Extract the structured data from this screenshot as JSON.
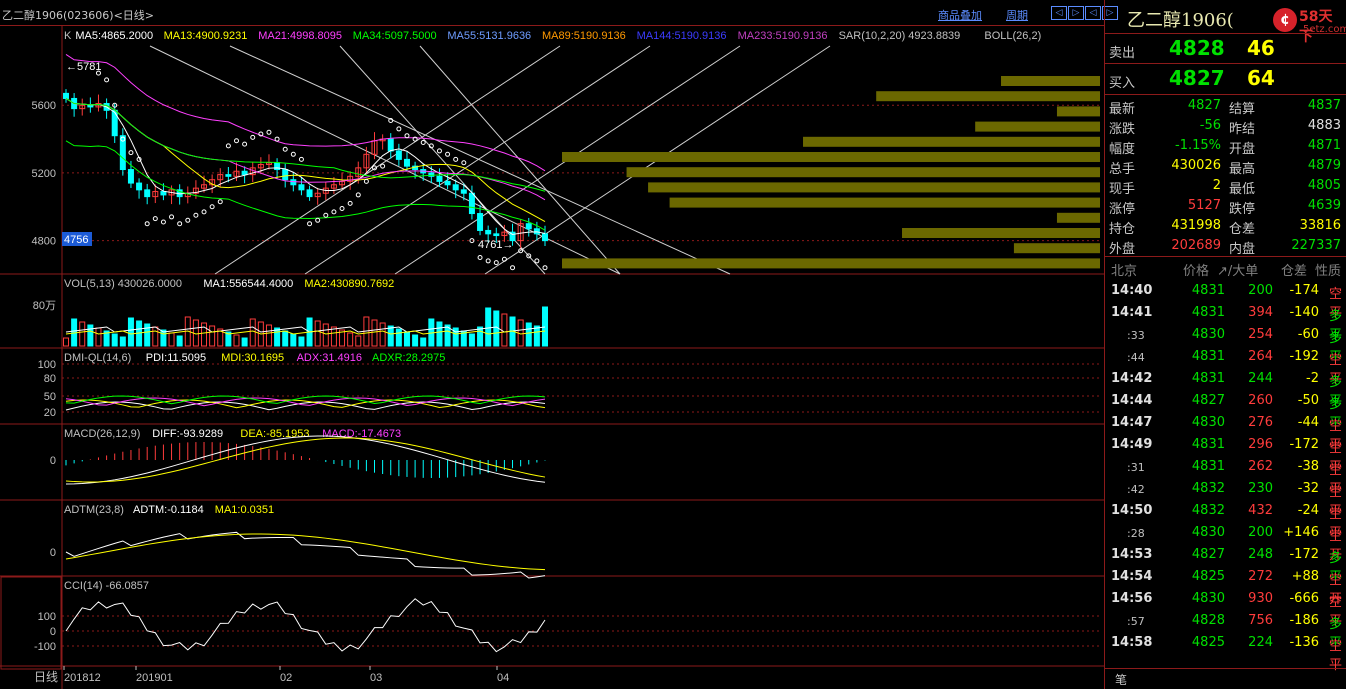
{
  "window_title": "乙二醇1906(023606)<日线>",
  "top_links": {
    "overlay": "商品叠加",
    "period": "周期"
  },
  "nav_buttons": [
    "◁",
    "▷",
    "◁",
    "▷"
  ],
  "colors": {
    "bg": "#000000",
    "up": "#ff3c3c",
    "down": "#00ffff",
    "grid": "#8c1a1a",
    "green": "#00e000",
    "yellow": "#ffff00"
  },
  "chart_data": [
    {
      "type": "candlestick",
      "ma_legend": [
        {
          "text": "K",
          "color": "#c0c0c0"
        },
        {
          "text": "MA5:4865.2000",
          "color": "#ffffff"
        },
        {
          "text": "MA13:4900.9231",
          "color": "#ffff00"
        },
        {
          "text": "MA21:4998.8095",
          "color": "#ff40ff"
        },
        {
          "text": "MA34:5097.5000",
          "color": "#00ff00"
        },
        {
          "text": "MA55:5131.9636",
          "color": "#6e9cff"
        },
        {
          "text": "MA89:5190.9136",
          "color": "#ff9900"
        },
        {
          "text": "MA144:5190.9136",
          "color": "#3c3cff"
        },
        {
          "text": "MA233:5190.9136",
          "color": "#c040c0"
        },
        {
          "text": "SAR(10,2,20) 4923.8839",
          "color": "#c0c0c0"
        },
        {
          "text": "BOLL(26,2)",
          "color": "#c0c0c0"
        }
      ],
      "y_ticks": [
        5600,
        5200,
        4800
      ],
      "ylim": [
        4650,
        5950
      ],
      "current_price_tag": "4756",
      "high_label": "←5781",
      "low_label": "4761→",
      "closes": [
        5640,
        5580,
        5600,
        5590,
        5610,
        5570,
        5420,
        5220,
        5140,
        5100,
        5060,
        5090,
        5070,
        5100,
        5060,
        5080,
        5110,
        5130,
        5160,
        5190,
        5180,
        5210,
        5190,
        5230,
        5250,
        5260,
        5220,
        5160,
        5130,
        5100,
        5060,
        5080,
        5110,
        5130,
        5150,
        5180,
        5230,
        5310,
        5390,
        5400,
        5330,
        5280,
        5240,
        5220,
        5200,
        5180,
        5150,
        5130,
        5100,
        5080,
        4960,
        4860,
        4840,
        4830,
        4850,
        4800,
        4900,
        4870,
        4840,
        4800
      ],
      "volume_profile": [
        0.23,
        0.52,
        0.1,
        0.29,
        0.69,
        1.25,
        1.1,
        1.05,
        1.0,
        0.1,
        0.46,
        0.2,
        1.25
      ],
      "x_labels": [
        "201812",
        "201901",
        "02",
        "03",
        "04"
      ]
    },
    {
      "type": "bar",
      "name": "VOL",
      "legend": [
        {
          "text": "VOL(5,13) 430026.0000",
          "color": "#c0c0c0"
        },
        {
          "text": "MA1:556544.4000",
          "color": "#ffffff"
        },
        {
          "text": "MA2:430890.7692",
          "color": "#ffff00"
        }
      ],
      "y_ticks": [
        "80万"
      ]
    },
    {
      "type": "line",
      "name": "DMI-QL",
      "legend": [
        {
          "text": "DMI-QL(14,6)",
          "color": "#c0c0c0"
        },
        {
          "text": "PDI:11.5095",
          "color": "#ffffff"
        },
        {
          "text": "MDI:30.1695",
          "color": "#ffff00"
        },
        {
          "text": "ADX:31.4916",
          "color": "#ff40ff"
        },
        {
          "text": "ADXR:28.2975",
          "color": "#00ff00"
        }
      ],
      "y_ticks": [
        "100",
        "80",
        "50",
        "20"
      ]
    },
    {
      "type": "bar",
      "name": "MACD",
      "legend": [
        {
          "text": "MACD(26,12,9)",
          "color": "#c0c0c0"
        },
        {
          "text": "DIFF:-93.9289",
          "color": "#ffffff"
        },
        {
          "text": "DEA:-85.1953",
          "color": "#ffff00"
        },
        {
          "text": "MACD:-17.4673",
          "color": "#ff40ff"
        }
      ],
      "y_ticks": [
        "0"
      ]
    },
    {
      "type": "line",
      "name": "ADTM",
      "legend": [
        {
          "text": "ADTM(23,8)",
          "color": "#c0c0c0"
        },
        {
          "text": "ADTM:-0.1184",
          "color": "#ffffff"
        },
        {
          "text": "MA1:0.0351",
          "color": "#ffff00"
        }
      ],
      "y_ticks": [
        "0"
      ]
    },
    {
      "type": "line",
      "name": "CCI",
      "legend": [
        {
          "text": "CCI(14) -66.0857",
          "color": "#c0c0c0"
        }
      ],
      "y_ticks": [
        "100",
        "0",
        "-100"
      ]
    }
  ],
  "period_label": "日线",
  "right": {
    "title": "乙二醇1906(",
    "logo_text": "58天下",
    "logo_sub": "5etz.com",
    "sell": {
      "label": "卖出",
      "price": "4828",
      "vol": "46"
    },
    "buy": {
      "label": "买入",
      "price": "4827",
      "vol": "64"
    },
    "stats": [
      {
        "k1": "最新",
        "v1": "4827",
        "c1": "#00e000",
        "k2": "结算",
        "v2": "4837",
        "c2": "#00e000"
      },
      {
        "k1": "涨跌",
        "v1": "-56",
        "c1": "#00e000",
        "k2": "昨结",
        "v2": "4883",
        "c2": "#e0e0e0"
      },
      {
        "k1": "幅度",
        "v1": "-1.15%",
        "c1": "#00e000",
        "k2": "开盘",
        "v2": "4871",
        "c2": "#00e000"
      },
      {
        "k1": "总手",
        "v1": "430026",
        "c1": "#ffff00",
        "k2": "最高",
        "v2": "4879",
        "c2": "#00e000"
      },
      {
        "k1": "现手",
        "v1": "2",
        "c1": "#ffff00",
        "k2": "最低",
        "v2": "4805",
        "c2": "#00e000"
      },
      {
        "k1": "涨停",
        "v1": "5127",
        "c1": "#ff3c3c",
        "k2": "跌停",
        "v2": "4639",
        "c2": "#00e000"
      },
      {
        "k1": "持仓",
        "v1": "431998",
        "c1": "#ffff00",
        "k2": "仓差",
        "v2": "33816",
        "c2": "#ffff00"
      },
      {
        "k1": "外盘",
        "v1": "202689",
        "c1": "#ff3c3c",
        "k2": "内盘",
        "v2": "227337",
        "c2": "#00e000"
      }
    ],
    "tick_header": {
      "loc": "北京",
      "price": "价格",
      "big": "↗/大单",
      "oi": "仓差",
      "nature": "性质"
    },
    "ticks": [
      {
        "t": "14:40",
        "sec": false,
        "p": "4831",
        "v": "200",
        "oi": "-174",
        "n": "空平"
      },
      {
        "t": "14:41",
        "sec": false,
        "p": "4831",
        "v": "394",
        "oi": "-140",
        "n": "多平"
      },
      {
        "t": ":33",
        "sec": true,
        "p": "4830",
        "v": "254",
        "oi": "-60",
        "n": "多平"
      },
      {
        "t": ":44",
        "sec": true,
        "p": "4831",
        "v": "264",
        "oi": "-192",
        "n": "空平"
      },
      {
        "t": "14:42",
        "sec": false,
        "p": "4831",
        "v": "244",
        "oi": "-2",
        "n": "多平"
      },
      {
        "t": "14:44",
        "sec": false,
        "p": "4827",
        "v": "260",
        "oi": "-50",
        "n": "多平"
      },
      {
        "t": "14:47",
        "sec": false,
        "p": "4830",
        "v": "276",
        "oi": "-44",
        "n": "空平"
      },
      {
        "t": "14:49",
        "sec": false,
        "p": "4831",
        "v": "296",
        "oi": "-172",
        "n": "空平"
      },
      {
        "t": ":31",
        "sec": true,
        "p": "4831",
        "v": "262",
        "oi": "-38",
        "n": "空平"
      },
      {
        "t": ":42",
        "sec": true,
        "p": "4832",
        "v": "230",
        "oi": "-32",
        "n": "空平"
      },
      {
        "t": "14:50",
        "sec": false,
        "p": "4832",
        "v": "432",
        "oi": "-24",
        "n": "空平"
      },
      {
        "t": ":28",
        "sec": true,
        "p": "4830",
        "v": "200",
        "oi": "+146",
        "n": "空开"
      },
      {
        "t": "14:53",
        "sec": false,
        "p": "4827",
        "v": "248",
        "oi": "-172",
        "n": "多平"
      },
      {
        "t": "14:54",
        "sec": false,
        "p": "4825",
        "v": "272",
        "oi": "+88",
        "n": "空开"
      },
      {
        "t": "14:56",
        "sec": false,
        "p": "4830",
        "v": "930",
        "oi": "-666",
        "n": "空平"
      },
      {
        "t": ":57",
        "sec": true,
        "p": "4828",
        "v": "756",
        "oi": "-186",
        "n": "多平"
      },
      {
        "t": "14:58",
        "sec": false,
        "p": "4825",
        "v": "224",
        "oi": "-136",
        "n": "空平"
      }
    ],
    "bottom_tab": "笔"
  }
}
